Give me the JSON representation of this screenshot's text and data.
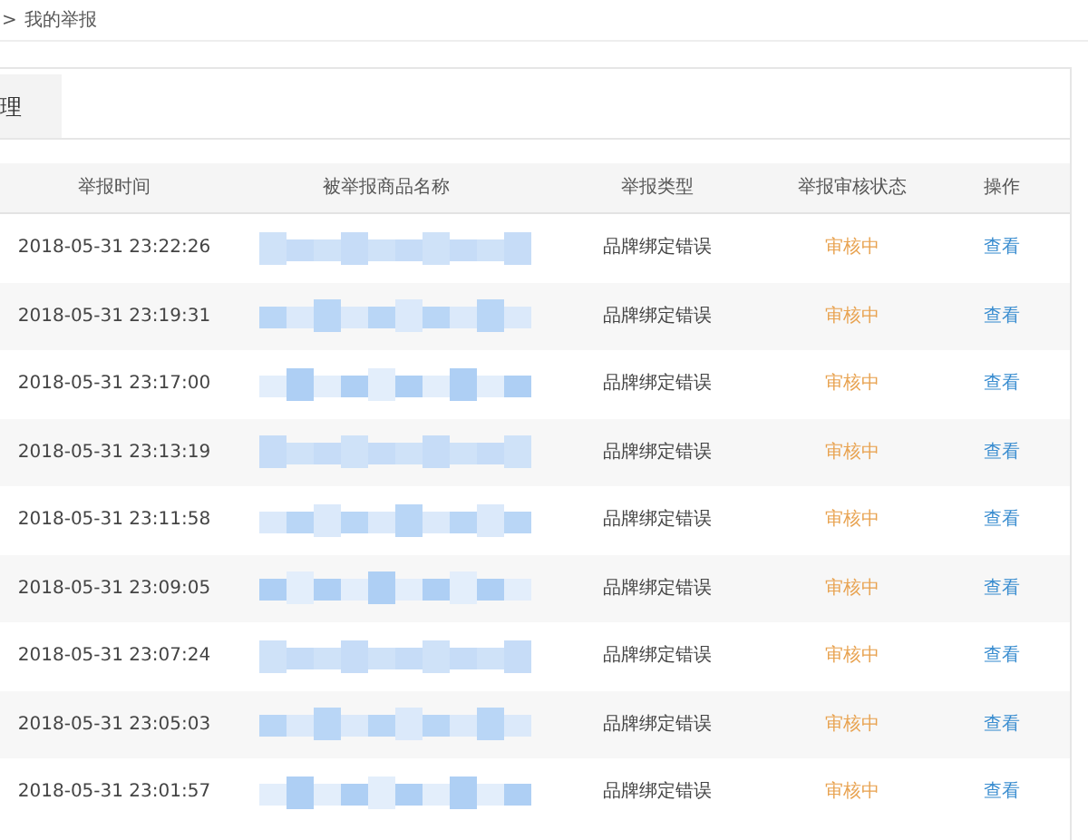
{
  "breadcrumb": {
    "separator": ">",
    "current": "我的举报"
  },
  "tabs": [
    {
      "label": "理",
      "selected": true
    }
  ],
  "table": {
    "columns": [
      "举报时间",
      "被举报商品名称",
      "举报类型",
      "举报审核状态",
      "操作"
    ],
    "rows": [
      {
        "time": "2018-05-31 23:22:26",
        "type": "品牌绑定错误",
        "status": "审核中",
        "action": "查看"
      },
      {
        "time": "2018-05-31 23:19:31",
        "type": "品牌绑定错误",
        "status": "审核中",
        "action": "查看"
      },
      {
        "time": "2018-05-31 23:17:00",
        "type": "品牌绑定错误",
        "status": "审核中",
        "action": "查看"
      },
      {
        "time": "2018-05-31 23:13:19",
        "type": "品牌绑定错误",
        "status": "审核中",
        "action": "查看"
      },
      {
        "time": "2018-05-31 23:11:58",
        "type": "品牌绑定错误",
        "status": "审核中",
        "action": "查看"
      },
      {
        "time": "2018-05-31 23:09:05",
        "type": "品牌绑定错误",
        "status": "审核中",
        "action": "查看"
      },
      {
        "time": "2018-05-31 23:07:24",
        "type": "品牌绑定错误",
        "status": "审核中",
        "action": "查看"
      },
      {
        "time": "2018-05-31 23:05:03",
        "type": "品牌绑定错误",
        "status": "审核中",
        "action": "查看"
      },
      {
        "time": "2018-05-31 23:01:57",
        "type": "品牌绑定错误",
        "status": "审核中",
        "action": "查看"
      }
    ]
  }
}
